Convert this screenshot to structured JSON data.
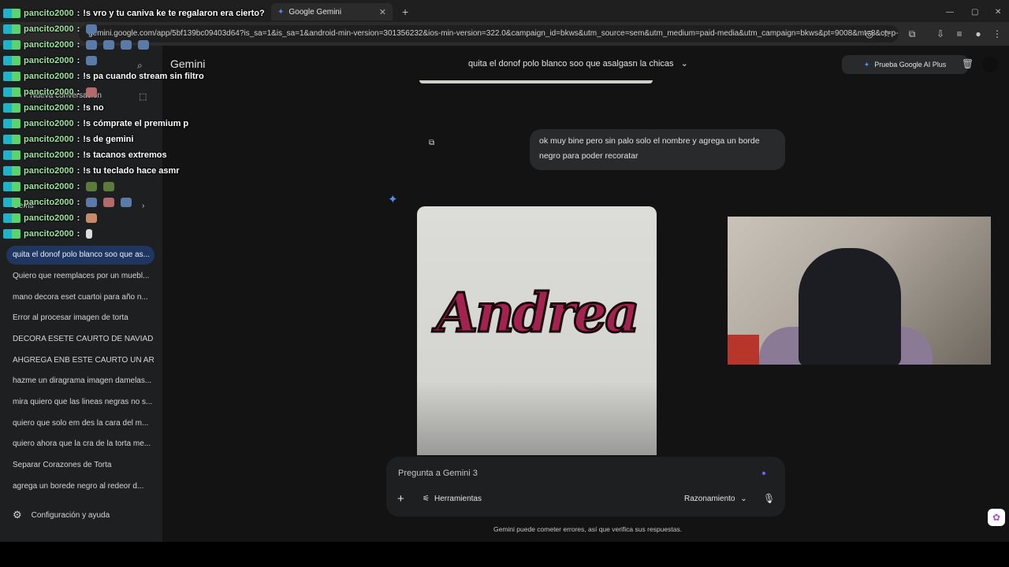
{
  "browser": {
    "tabs": [
      {
        "label": "Google Gemini",
        "active": true
      }
    ],
    "url": "gemini.google.com/app/5bf139bc09403d64?is_sa=1&is_sa=1&android-min-version=301356232&ios-min-version=322.0&campaign_id=bkws&utm_source=sem&utm_medium=paid-media&utm_campaign=bkws&pt=9008&mt=8&ct=p-..."
  },
  "sidebar": {
    "new_chat": "Nueva conversación",
    "gems": "Gems",
    "recent_items": [
      "quita el donof polo blanco soo que as...",
      "Quiero que reemplaces por un muebl...",
      "mano decora eset cuartoi para año n...",
      "Error al procesar imagen de torta",
      "DECORA ESETE CAURTO DE NAVIAD ...",
      "AHGREGA ENB ESTE CAURTO UN AR...",
      "hazme un diragrama imagen damelas...",
      "mira quiero que las lineas negras no s...",
      "quiero que solo em des la cara del m...",
      "quiero ahora que la cra de la torta me...",
      "Separar Corazones de Torta",
      "agrega un borede negro al redeor d..."
    ],
    "settings_label": "Configuración y ayuda"
  },
  "header": {
    "brand": "Gemini",
    "conversation_title": "quita el donof polo blanco soo que asalgasn la chicas",
    "upgrade_label": "Prueba Google AI Plus"
  },
  "conversation": {
    "user_message": "ok muy bine pero sin palo solo el nombre y agrega un borde negro para poder recoratar",
    "generated_image_text": "Andrea"
  },
  "composer": {
    "placeholder": "Pregunta a Gemini 3",
    "tools_label": "Herramientas",
    "mode_label": "Razonamiento"
  },
  "disclaimer": "Gemini puede cometer errores, así que verifica sus respuestas.",
  "chat_overlay": [
    {
      "user": "pancito2000",
      "text": "!s vro y tu caniva ke te regalaron era cierto?"
    },
    {
      "user": "pancito2000",
      "text": ""
    },
    {
      "user": "pancito2000",
      "text": ""
    },
    {
      "user": "pancito2000",
      "text": ""
    },
    {
      "user": "pancito2000",
      "text": "!s pa cuando stream sin filtro"
    },
    {
      "user": "pancito2000",
      "text": ""
    },
    {
      "user": "pancito2000",
      "text": "!s no"
    },
    {
      "user": "pancito2000",
      "text": "!s cómprate el premium p"
    },
    {
      "user": "pancito2000",
      "text": "!s de gemini"
    },
    {
      "user": "pancito2000",
      "text": "!s tacanos extremos"
    },
    {
      "user": "pancito2000",
      "text": "!s tu teclado hace asmr"
    },
    {
      "user": "pancito2000",
      "text": ""
    },
    {
      "user": "pancito2000",
      "text": ""
    },
    {
      "user": "pancito2000",
      "text": ""
    },
    {
      "user": "pancito2000",
      "text": ""
    }
  ]
}
